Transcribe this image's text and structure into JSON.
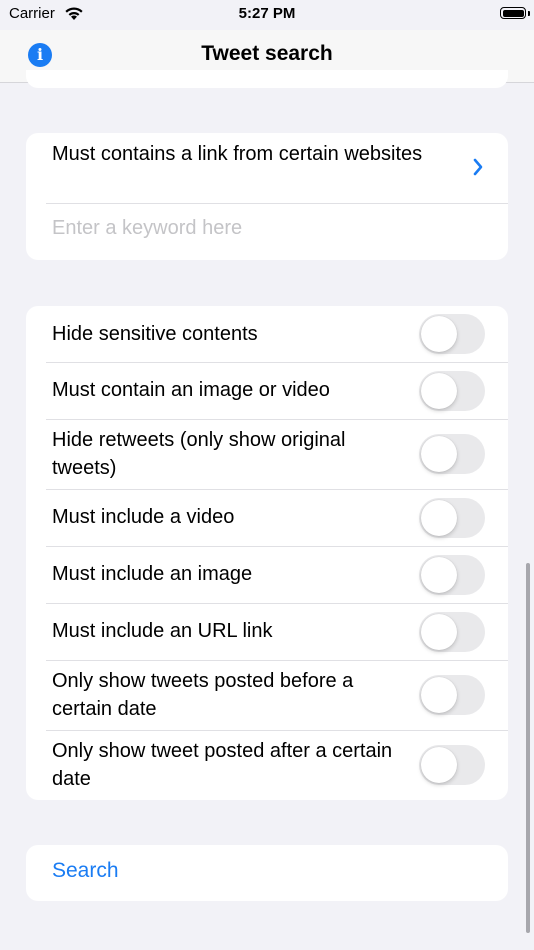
{
  "status_bar": {
    "carrier": "Carrier",
    "time": "5:27 PM",
    "battery_level": 1.0
  },
  "nav": {
    "title": "Tweet search",
    "info_icon": "info-circle-icon"
  },
  "link_filter": {
    "label": "Must contains a link from certain websites",
    "keyword_value": "",
    "keyword_placeholder": "Enter a keyword here"
  },
  "filters": [
    {
      "label": "Hide sensitive contents",
      "on": false
    },
    {
      "label": "Must contain an image or video",
      "on": false
    },
    {
      "label": "Hide retweets (only show original tweets)",
      "on": false
    },
    {
      "label": "Must include a video",
      "on": false
    },
    {
      "label": "Must include an image",
      "on": false
    },
    {
      "label": "Must include an URL link",
      "on": false
    },
    {
      "label": "Only show tweets posted before a certain date",
      "on": false
    },
    {
      "label": "Only show tweet posted after a certain date",
      "on": false
    }
  ],
  "search_button": {
    "label": "Search"
  },
  "colors": {
    "accent": "#1a7cf3",
    "background": "#f2f2f7",
    "toggle_off": "#e9e9eb"
  }
}
